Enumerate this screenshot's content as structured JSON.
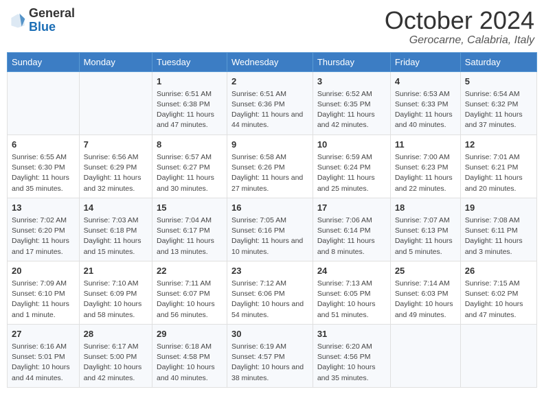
{
  "logo": {
    "general": "General",
    "blue": "Blue"
  },
  "title": "October 2024",
  "location": "Gerocarne, Calabria, Italy",
  "days_header": [
    "Sunday",
    "Monday",
    "Tuesday",
    "Wednesday",
    "Thursday",
    "Friday",
    "Saturday"
  ],
  "weeks": [
    [
      {
        "day": "",
        "content": ""
      },
      {
        "day": "",
        "content": ""
      },
      {
        "day": "1",
        "content": "Sunrise: 6:51 AM\nSunset: 6:38 PM\nDaylight: 11 hours and 47 minutes."
      },
      {
        "day": "2",
        "content": "Sunrise: 6:51 AM\nSunset: 6:36 PM\nDaylight: 11 hours and 44 minutes."
      },
      {
        "day": "3",
        "content": "Sunrise: 6:52 AM\nSunset: 6:35 PM\nDaylight: 11 hours and 42 minutes."
      },
      {
        "day": "4",
        "content": "Sunrise: 6:53 AM\nSunset: 6:33 PM\nDaylight: 11 hours and 40 minutes."
      },
      {
        "day": "5",
        "content": "Sunrise: 6:54 AM\nSunset: 6:32 PM\nDaylight: 11 hours and 37 minutes."
      }
    ],
    [
      {
        "day": "6",
        "content": "Sunrise: 6:55 AM\nSunset: 6:30 PM\nDaylight: 11 hours and 35 minutes."
      },
      {
        "day": "7",
        "content": "Sunrise: 6:56 AM\nSunset: 6:29 PM\nDaylight: 11 hours and 32 minutes."
      },
      {
        "day": "8",
        "content": "Sunrise: 6:57 AM\nSunset: 6:27 PM\nDaylight: 11 hours and 30 minutes."
      },
      {
        "day": "9",
        "content": "Sunrise: 6:58 AM\nSunset: 6:26 PM\nDaylight: 11 hours and 27 minutes."
      },
      {
        "day": "10",
        "content": "Sunrise: 6:59 AM\nSunset: 6:24 PM\nDaylight: 11 hours and 25 minutes."
      },
      {
        "day": "11",
        "content": "Sunrise: 7:00 AM\nSunset: 6:23 PM\nDaylight: 11 hours and 22 minutes."
      },
      {
        "day": "12",
        "content": "Sunrise: 7:01 AM\nSunset: 6:21 PM\nDaylight: 11 hours and 20 minutes."
      }
    ],
    [
      {
        "day": "13",
        "content": "Sunrise: 7:02 AM\nSunset: 6:20 PM\nDaylight: 11 hours and 17 minutes."
      },
      {
        "day": "14",
        "content": "Sunrise: 7:03 AM\nSunset: 6:18 PM\nDaylight: 11 hours and 15 minutes."
      },
      {
        "day": "15",
        "content": "Sunrise: 7:04 AM\nSunset: 6:17 PM\nDaylight: 11 hours and 13 minutes."
      },
      {
        "day": "16",
        "content": "Sunrise: 7:05 AM\nSunset: 6:16 PM\nDaylight: 11 hours and 10 minutes."
      },
      {
        "day": "17",
        "content": "Sunrise: 7:06 AM\nSunset: 6:14 PM\nDaylight: 11 hours and 8 minutes."
      },
      {
        "day": "18",
        "content": "Sunrise: 7:07 AM\nSunset: 6:13 PM\nDaylight: 11 hours and 5 minutes."
      },
      {
        "day": "19",
        "content": "Sunrise: 7:08 AM\nSunset: 6:11 PM\nDaylight: 11 hours and 3 minutes."
      }
    ],
    [
      {
        "day": "20",
        "content": "Sunrise: 7:09 AM\nSunset: 6:10 PM\nDaylight: 11 hours and 1 minute."
      },
      {
        "day": "21",
        "content": "Sunrise: 7:10 AM\nSunset: 6:09 PM\nDaylight: 10 hours and 58 minutes."
      },
      {
        "day": "22",
        "content": "Sunrise: 7:11 AM\nSunset: 6:07 PM\nDaylight: 10 hours and 56 minutes."
      },
      {
        "day": "23",
        "content": "Sunrise: 7:12 AM\nSunset: 6:06 PM\nDaylight: 10 hours and 54 minutes."
      },
      {
        "day": "24",
        "content": "Sunrise: 7:13 AM\nSunset: 6:05 PM\nDaylight: 10 hours and 51 minutes."
      },
      {
        "day": "25",
        "content": "Sunrise: 7:14 AM\nSunset: 6:03 PM\nDaylight: 10 hours and 49 minutes."
      },
      {
        "day": "26",
        "content": "Sunrise: 7:15 AM\nSunset: 6:02 PM\nDaylight: 10 hours and 47 minutes."
      }
    ],
    [
      {
        "day": "27",
        "content": "Sunrise: 6:16 AM\nSunset: 5:01 PM\nDaylight: 10 hours and 44 minutes."
      },
      {
        "day": "28",
        "content": "Sunrise: 6:17 AM\nSunset: 5:00 PM\nDaylight: 10 hours and 42 minutes."
      },
      {
        "day": "29",
        "content": "Sunrise: 6:18 AM\nSunset: 4:58 PM\nDaylight: 10 hours and 40 minutes."
      },
      {
        "day": "30",
        "content": "Sunrise: 6:19 AM\nSunset: 4:57 PM\nDaylight: 10 hours and 38 minutes."
      },
      {
        "day": "31",
        "content": "Sunrise: 6:20 AM\nSunset: 4:56 PM\nDaylight: 10 hours and 35 minutes."
      },
      {
        "day": "",
        "content": ""
      },
      {
        "day": "",
        "content": ""
      }
    ]
  ]
}
